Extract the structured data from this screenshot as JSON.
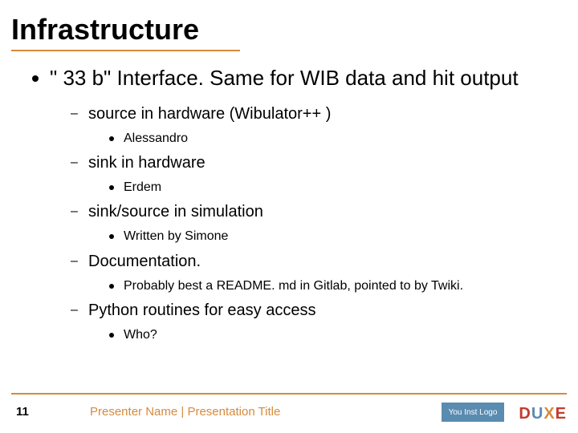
{
  "title": "Infrastructure",
  "bullets": {
    "lvl1_0": "\" 33 b\" Interface. Same for WIB data and hit output",
    "lvl2_0": "source in hardware (Wibulator++ )",
    "lvl3_0": "Alessandro",
    "lvl2_1": "sink in hardware",
    "lvl3_1": "Erdem",
    "lvl2_2": "sink/source in simulation",
    "lvl3_2": "Written by Simone",
    "lvl2_3": "Documentation.",
    "lvl3_3": "Probably best a README. md in Gitlab, pointed to by Twiki.",
    "lvl2_4": "Python routines for easy access",
    "lvl3_4": "Who?"
  },
  "footer": {
    "page": "11",
    "text": "Presenter Name | Presentation Title",
    "inst_logo": "You Inst Logo"
  },
  "logo": {
    "d": "D",
    "u": "U",
    "x": "X",
    "e": "E"
  }
}
